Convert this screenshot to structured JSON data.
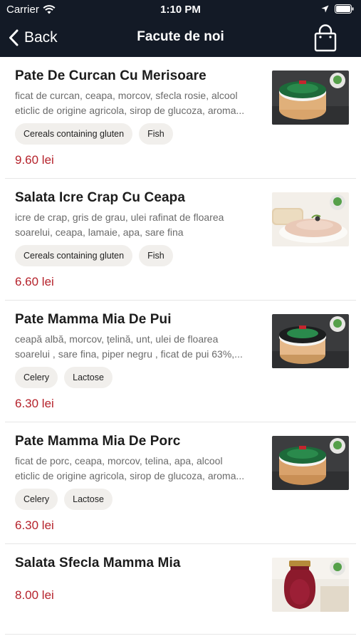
{
  "status_bar": {
    "carrier": "Carrier",
    "time": "1:10 PM"
  },
  "nav": {
    "back_label": "Back",
    "title": "Facute de noi"
  },
  "colors": {
    "bar_bg": "#131a26",
    "price": "#b5222b",
    "tag_bg": "#f1efec"
  },
  "products": [
    {
      "name": "Pate De Curcan Cu Merisoare",
      "desc_line1": "ficat de curcan, ceapa, morcov, sfecla rosie, alcool",
      "desc_line2": "eticlic de origine agricola, sirop de glucoza, aroma...",
      "tags": [
        "Cereals containing gluten",
        "Fish"
      ],
      "price": "9.60 lei",
      "image": "pate-jar-photo"
    },
    {
      "name": "Salata Icre Crap Cu Ceapa",
      "desc_line1": "icre de crap, gris de grau, ulei rafinat de floarea",
      "desc_line2": "soarelui, ceapa, lamaie, apa, sare fina",
      "tags": [
        "Cereals containing gluten",
        "Fish"
      ],
      "price": "6.60 lei",
      "image": "fish-roe-salad-photo"
    },
    {
      "name": "Pate Mamma Mia De Pui",
      "desc_line1": "ceapă albă, morcov, țelină, unt, ulei de floarea",
      "desc_line2": "soarelui , sare fina, piper negru , ficat de pui 63%,...",
      "tags": [
        "Celery",
        "Lactose"
      ],
      "price": "6.30 lei",
      "image": "pate-jar-photo"
    },
    {
      "name": "Pate Mamma Mia De Porc",
      "desc_line1": "ficat de porc, ceapa, morcov, telina, apa, alcool",
      "desc_line2": "eticlic de origine agricola, sirop de glucoza, aroma...",
      "tags": [
        "Celery",
        "Lactose"
      ],
      "price": "6.30 lei",
      "image": "pate-jar-photo"
    },
    {
      "name": "Salata Sfecla Mamma Mia",
      "price": "8.00 lei",
      "image": "beet-salad-jar-photo"
    }
  ]
}
